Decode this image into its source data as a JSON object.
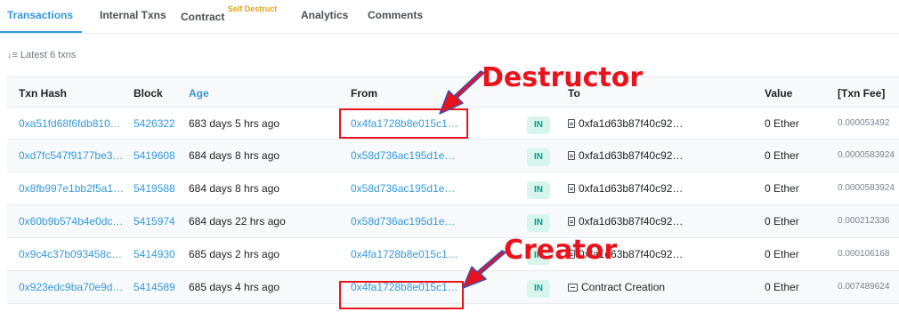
{
  "tabs": [
    {
      "label": "Transactions",
      "active": true
    },
    {
      "label": "Internal Txns"
    },
    {
      "label": "Contract",
      "sup": "Self Destruct"
    },
    {
      "label": "Analytics"
    },
    {
      "label": "Comments"
    }
  ],
  "latest_label": "Latest 6 txns",
  "columns": {
    "hash": "Txn Hash",
    "block": "Block",
    "age": "Age",
    "from": "From",
    "to": "To",
    "value": "Value",
    "fee": "[Txn Fee]"
  },
  "direction_badge": "IN",
  "rows": [
    {
      "hash": "0xa51fd68f6fdb810…",
      "block": "5426322",
      "age": "683 days 5 hrs ago",
      "from": "0x4fa1728b8e015c1…",
      "to": "0xfa1d63b87f40c92…",
      "value": "0 Ether",
      "fee": "0.000053492"
    },
    {
      "hash": "0xd7fc547f9177be3…",
      "block": "5419608",
      "age": "684 days 8 hrs ago",
      "from": "0x58d736ac195d1e…",
      "to": "0xfa1d63b87f40c92…",
      "value": "0 Ether",
      "fee": "0.0000583924"
    },
    {
      "hash": "0x8fb997e1bb2f5a1…",
      "block": "5419588",
      "age": "684 days 8 hrs ago",
      "from": "0x58d736ac195d1e…",
      "to": "0xfa1d63b87f40c92…",
      "value": "0 Ether",
      "fee": "0.0000583924"
    },
    {
      "hash": "0x60b9b574b4e0dc…",
      "block": "5415974",
      "age": "684 days 22 hrs ago",
      "from": "0x58d736ac195d1e…",
      "to": "0xfa1d63b87f40c92…",
      "value": "0 Ether",
      "fee": "0.000212336"
    },
    {
      "hash": "0x9c4c37b093458c…",
      "block": "5414930",
      "age": "685 days 2 hrs ago",
      "from": "0x4fa1728b8e015c1…",
      "to": "0xfa1d63b87f40c92…",
      "value": "0 Ether",
      "fee": "0.000106168"
    },
    {
      "hash": "0x923edc9ba70e9d…",
      "block": "5414589",
      "age": "685 days 4 hrs ago",
      "from": "0x4fa1728b8e015c1…",
      "to": "Contract Creation",
      "value": "0 Ether",
      "fee": "0.007489624"
    }
  ],
  "annotations": {
    "destructor": "Destructor",
    "creator": "Creator"
  },
  "colors": {
    "accent": "#3498db",
    "annotation": "#e8141d",
    "badge_in_bg": "#d7f5ec",
    "badge_in_text": "#00a186"
  }
}
